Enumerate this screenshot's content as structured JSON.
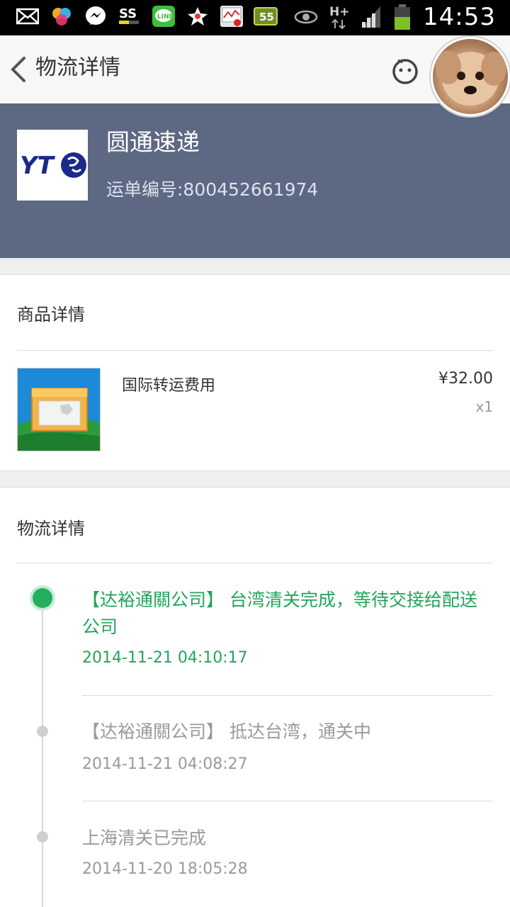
{
  "status_bar": {
    "time": "14:53",
    "network": "H+",
    "badge": "55",
    "icons": [
      "mail-icon",
      "color-app-icon",
      "messenger-icon",
      "ss-icon",
      "line-icon",
      "star-icon",
      "calendar-icon",
      "notification-55-icon",
      "eye-icon",
      "network-hplus-icon",
      "signal-icon",
      "battery-icon"
    ]
  },
  "topbar": {
    "title": "物流详情"
  },
  "shipment": {
    "company": "圆通速递",
    "waybill": "运单编号:800452661974",
    "logo_text": "YT"
  },
  "product_section": {
    "title": "商品详情",
    "item": {
      "name": "国际转运费用",
      "price": "¥32.00",
      "quantity": "x1"
    }
  },
  "logistics_section": {
    "title": "物流详情",
    "events": [
      {
        "text": "【达裕通關公司】 台湾清关完成，等待交接给配送公司",
        "time": "2014-11-21 04:10:17",
        "status": "current"
      },
      {
        "text": "【达裕通關公司】 抵达台湾，通关中",
        "time": "2014-11-21 04:08:27",
        "status": "past"
      },
      {
        "text": "上海清关已完成",
        "time": "2014-11-20 18:05:28",
        "status": "past"
      }
    ]
  },
  "colors": {
    "header_bg": "#5d6883",
    "active_green": "#22b05c",
    "text_grey": "#9a9a9a"
  }
}
